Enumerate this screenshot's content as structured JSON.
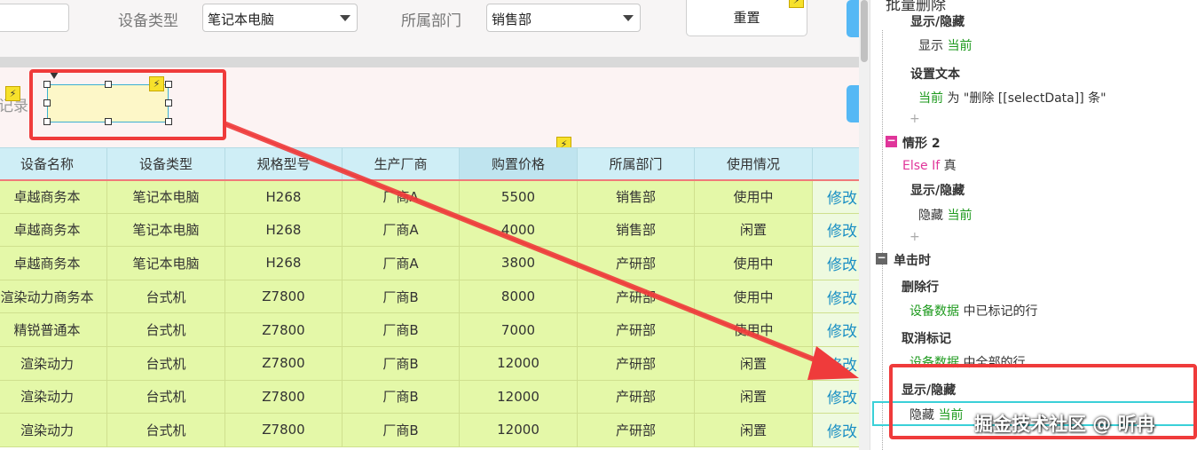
{
  "filters": {
    "device_type_label": "设备类型",
    "device_type_value": "笔记本电脑",
    "department_label": "所属部门",
    "department_value": "销售部",
    "reset_label": "重置"
  },
  "record_text": "记录",
  "table": {
    "columns": [
      "设备名称",
      "设备类型",
      "规格型号",
      "生产厂商",
      "购置价格",
      "所属部门",
      "使用情况",
      ""
    ],
    "rows": [
      {
        "name": "卓越商务本",
        "type": "笔记本电脑",
        "model": "H268",
        "maker": "厂商A",
        "price": "5500",
        "dept": "销售部",
        "status": "使用中",
        "action": "修改"
      },
      {
        "name": "卓越商务本",
        "type": "笔记本电脑",
        "model": "H268",
        "maker": "厂商A",
        "price": "4000",
        "dept": "销售部",
        "status": "闲置",
        "action": "修改"
      },
      {
        "name": "卓越商务本",
        "type": "笔记本电脑",
        "model": "H268",
        "maker": "厂商A",
        "price": "3800",
        "dept": "产研部",
        "status": "使用中",
        "action": "修改"
      },
      {
        "name": "渲染动力商务本",
        "type": "台式机",
        "model": "Z7800",
        "maker": "厂商B",
        "price": "8000",
        "dept": "产研部",
        "status": "使用中",
        "action": "修改"
      },
      {
        "name": "精锐普通本",
        "type": "台式机",
        "model": "Z7800",
        "maker": "厂商B",
        "price": "7000",
        "dept": "产研部",
        "status": "使用中",
        "action": "修改"
      },
      {
        "name": "渲染动力",
        "type": "台式机",
        "model": "Z7800",
        "maker": "厂商B",
        "price": "12000",
        "dept": "产研部",
        "status": "闲置",
        "action": "修改"
      },
      {
        "name": "渲染动力",
        "type": "台式机",
        "model": "Z7800",
        "maker": "厂商B",
        "price": "12000",
        "dept": "产研部",
        "status": "闲置",
        "action": "修改"
      },
      {
        "name": "渲染动力",
        "type": "台式机",
        "model": "Z7800",
        "maker": "厂商B",
        "price": "12000",
        "dept": "产研部",
        "status": "闲置",
        "action": "修改"
      }
    ]
  },
  "panel": {
    "title": "批量删除",
    "top_heading": "显示/隐藏",
    "show_word": "显示",
    "current": "当前",
    "set_text": "设置文本",
    "as_word": "为",
    "set_text_value": "\"删除 [[selectData]] 条\"",
    "case2": "情形 2",
    "else_if": "Else If",
    "true_word": "真",
    "show_hide": "显示/隐藏",
    "hide_word": "隐藏",
    "on_click": "单击时",
    "delete_rows": "删除行",
    "device_data": "设备数据",
    "marked_rows_suffix": "中已标记的行",
    "unmark": "取消标记",
    "all_rows_suffix": "中全部的行",
    "plus": "+"
  },
  "watermark": "掘金技术社区 @ 昕冉",
  "colors": {
    "accent_blue": "#55b8f5",
    "highlight_red": "#ef3b3b",
    "row_green": "#e4f8a8",
    "header_cyan": "#cfeef6",
    "keyword_green": "#1e9a1e",
    "keyword_pink": "#e0359a"
  }
}
